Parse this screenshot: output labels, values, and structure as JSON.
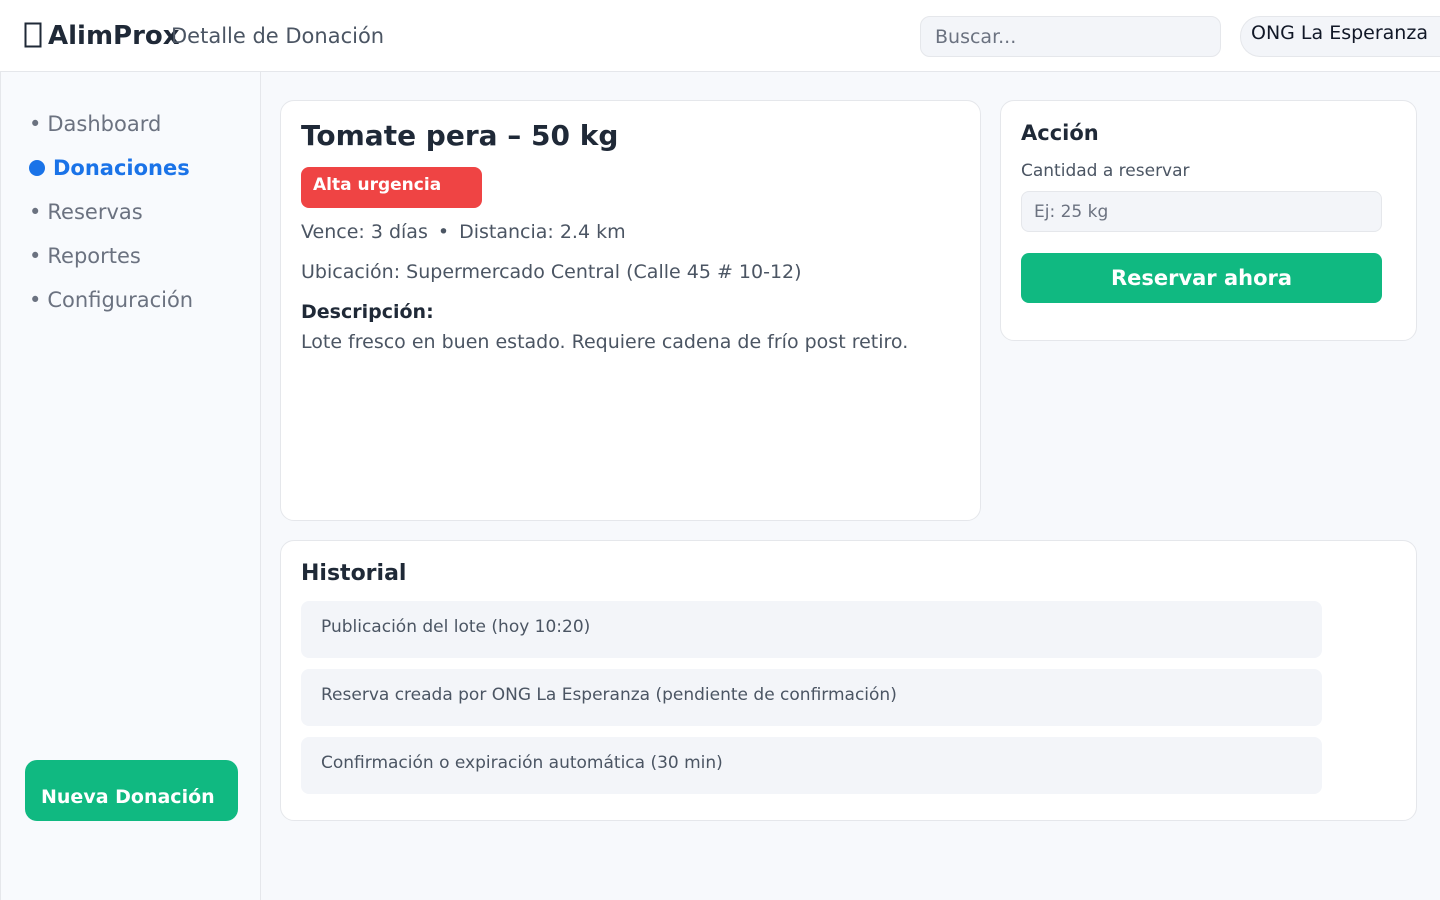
{
  "header": {
    "logo_icon": "box-icon",
    "app_name": "AlimProx",
    "page_title": "Detalle de Donación",
    "search_placeholder": "Buscar...",
    "org_name": "ONG La Esperanza"
  },
  "sidebar": {
    "items": [
      {
        "label": "Dashboard",
        "active": false
      },
      {
        "label": "Donaciones",
        "active": true
      },
      {
        "label": "Reservas",
        "active": false
      },
      {
        "label": "Reportes",
        "active": false
      },
      {
        "label": "Configuración",
        "active": false
      }
    ],
    "bullet": "•",
    "new_donation_label": "Nueva Donación"
  },
  "detail": {
    "title": "Tomate pera – 50 kg",
    "urgency": "Alta urgencia",
    "expires": "Vence: 3 días",
    "separator": "•",
    "distance": "Distancia: 2.4 km",
    "location": "Ubicación: Supermercado Central (Calle 45 # 10-12)",
    "description_label": "Descripción:",
    "description": "Lote fresco en buen estado. Requiere cadena de frío post retiro."
  },
  "action": {
    "heading": "Acción",
    "quantity_label": "Cantidad a reservar",
    "quantity_placeholder": "Ej: 25 kg",
    "reserve_label": "Reservar ahora"
  },
  "history": {
    "heading": "Historial",
    "items": [
      "Publicación del lote (hoy 10:20)",
      "Reserva creada por ONG La Esperanza (pendiente de confirmación)",
      "Confirmación o expiración automática (30 min)"
    ]
  },
  "colors": {
    "accent": "#1a73e8",
    "primary_button": "#10b981",
    "urgency": "#ef4444"
  }
}
